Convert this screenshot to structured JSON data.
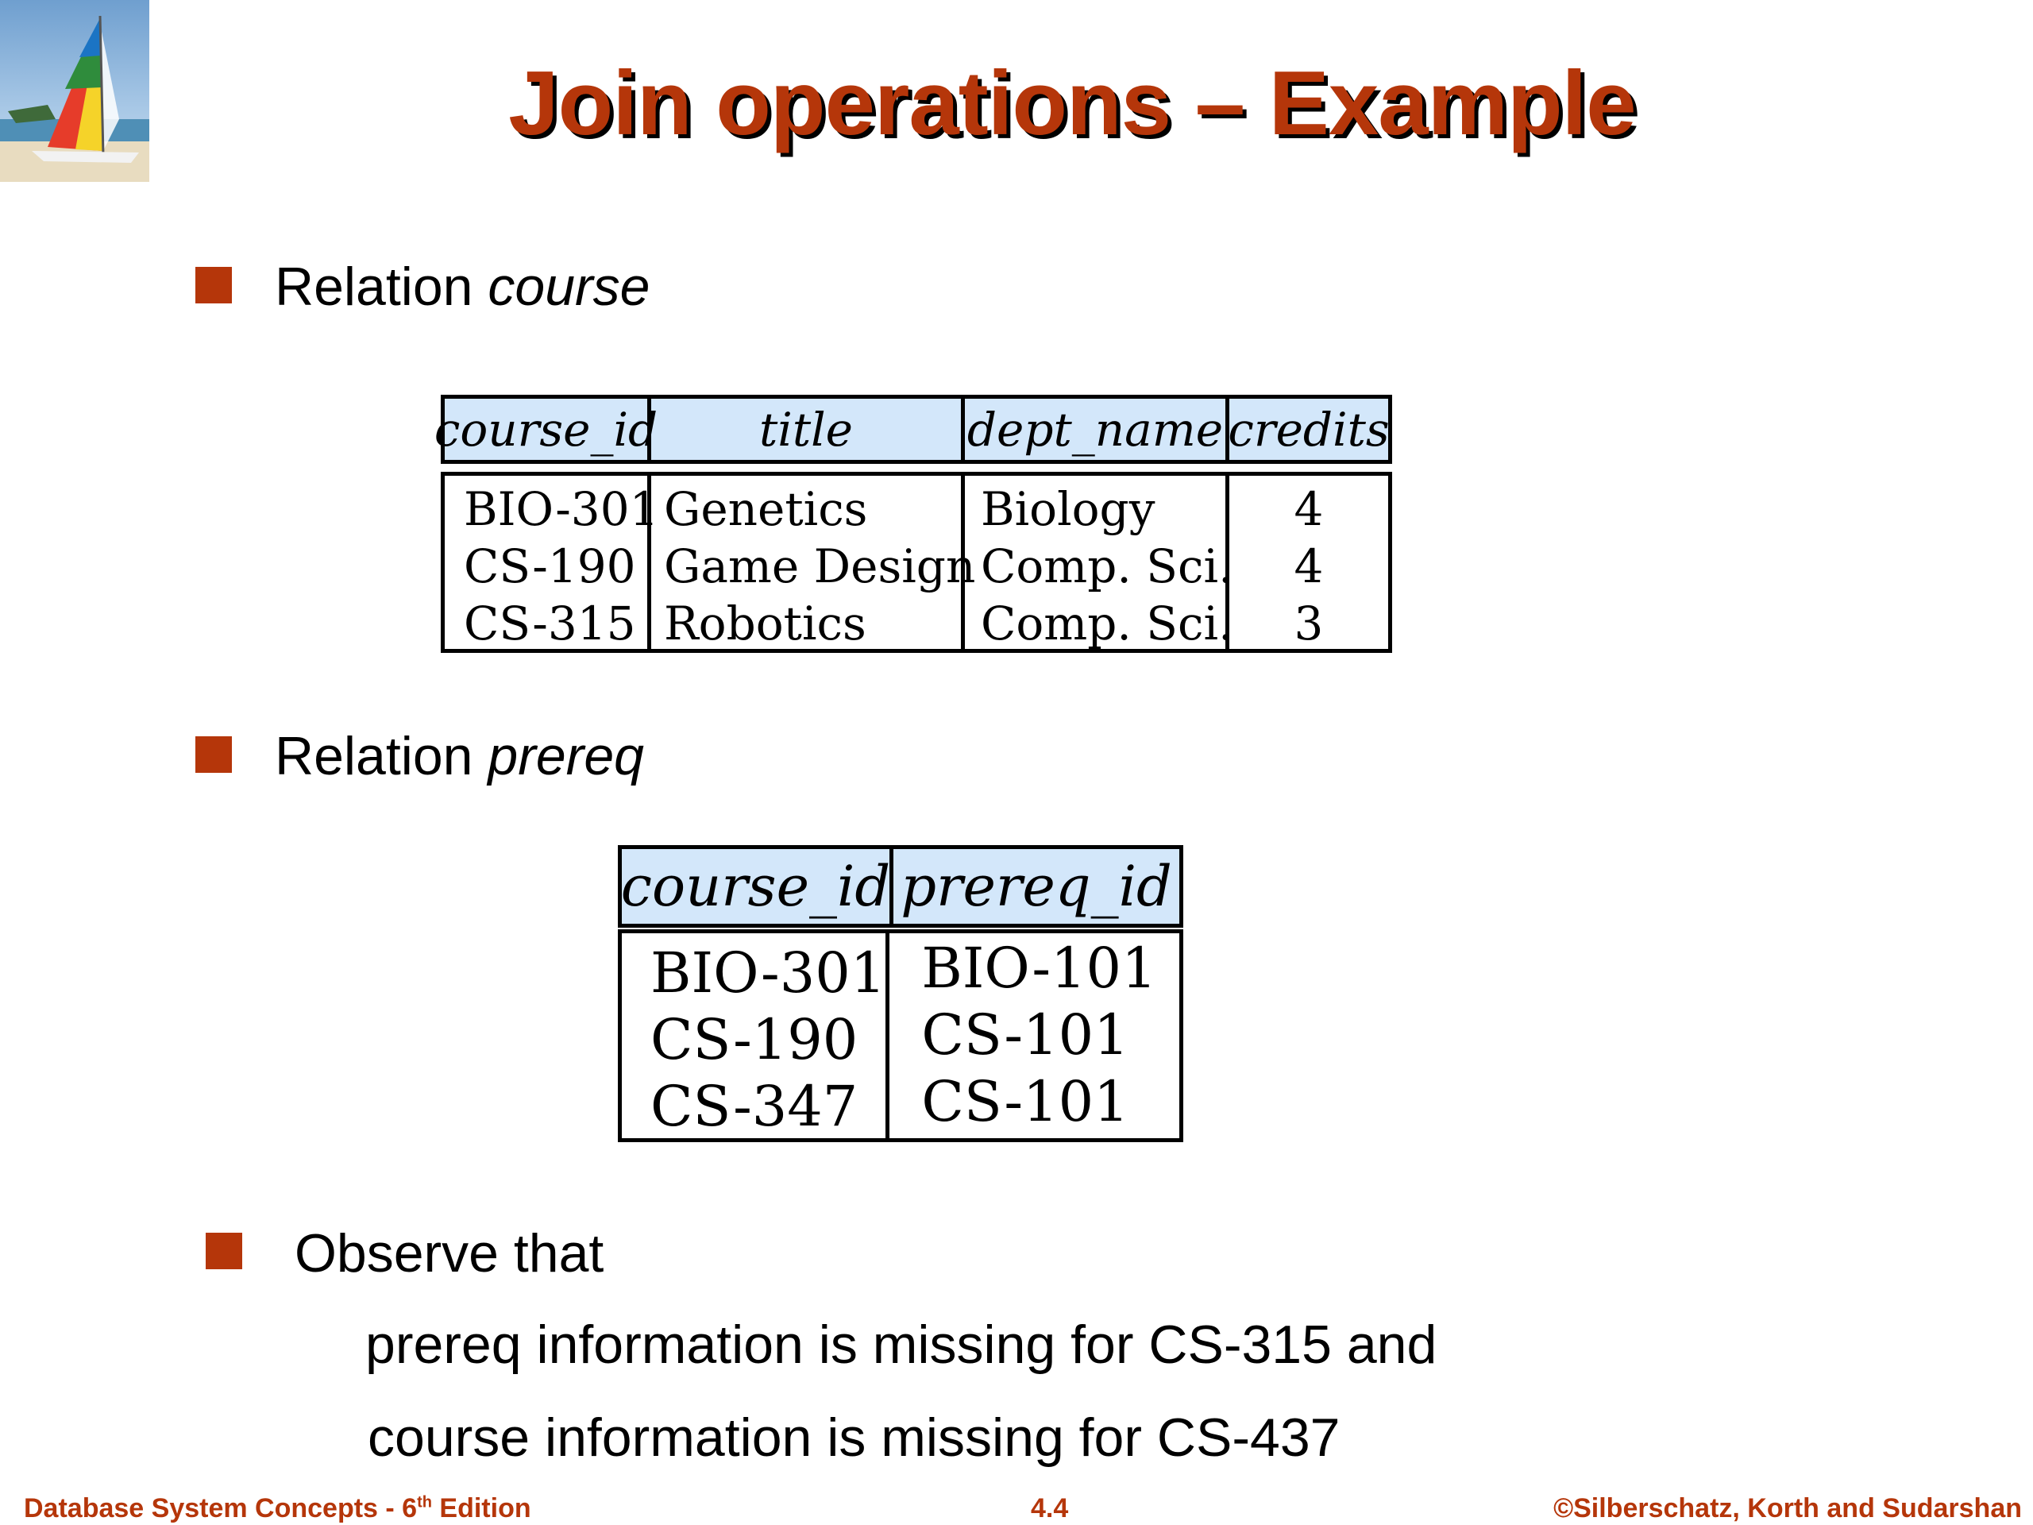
{
  "slide": {
    "title": "Join operations – Example",
    "accent_color": "#b5360a",
    "header_bg": "#d3e7fa"
  },
  "bullets": [
    {
      "prefix": "Relation ",
      "emph": "course"
    },
    {
      "prefix": "Relation ",
      "emph": "prereq"
    },
    {
      "text": "Observe that"
    }
  ],
  "observation_lines": [
    "prereq information is missing for CS-315 and",
    "course information is missing  for  CS-437"
  ],
  "course_table": {
    "columns": [
      "course_id",
      "title",
      "dept_name",
      "credits"
    ],
    "rows": [
      [
        "BIO-301",
        "Genetics",
        "Biology",
        "4"
      ],
      [
        "CS-190",
        "Game Design",
        "Comp. Sci.",
        "4"
      ],
      [
        "CS-315",
        "Robotics",
        "Comp. Sci.",
        "3"
      ]
    ]
  },
  "prereq_table": {
    "columns": [
      "course_id",
      "prereq_id"
    ],
    "rows": [
      [
        "BIO-301",
        "BIO-101"
      ],
      [
        "CS-190",
        "CS-101"
      ],
      [
        "CS-347",
        "CS-101"
      ]
    ]
  },
  "footer": {
    "left_main": "Database System Concepts - 6",
    "left_sup": "th",
    "left_tail": " Edition",
    "center": "4.4",
    "right": "©Silberschatz, Korth and Sudarshan"
  },
  "logo_icon": "sailboat-logo-icon"
}
